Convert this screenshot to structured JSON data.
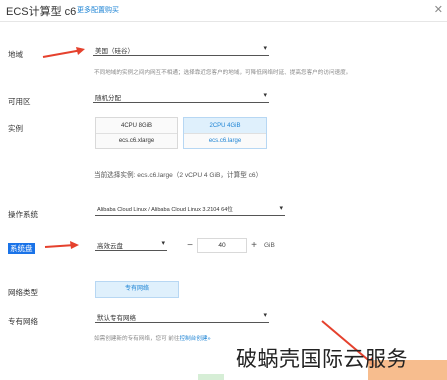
{
  "header": {
    "title": "ECS计算型 c6",
    "more_link": "更多配置购买",
    "close": "✕"
  },
  "region": {
    "label": "地域",
    "value": "美国（硅谷）",
    "hint": "不同地域的实例之间内网互不相通；选择靠近您客户的地域，可降低网络时延、提高您客户的访问速度。"
  },
  "zone": {
    "label": "可用区",
    "value": "随机分配"
  },
  "instance": {
    "label": "实例",
    "cards": [
      {
        "spec": "4CPU 8GiB",
        "code": "ecs.c6.xlarge",
        "active": false
      },
      {
        "spec": "2CPU 4GiB",
        "code": "ecs.c6.large",
        "active": true
      }
    ],
    "current": "当前选择实例: ecs.c6.large（2 vCPU 4 GiB，计算型 c6）"
  },
  "os": {
    "label": "操作系统",
    "value": "Alibaba Cloud Linux / Alibaba Cloud Linux 3.2104 64位"
  },
  "system_disk": {
    "label": "系统盘",
    "type": "高效云盘",
    "minus": "−",
    "size": "40",
    "plus": "+",
    "unit": "GiB"
  },
  "network_type": {
    "label": "网络类型",
    "option": "专有网络"
  },
  "vpc": {
    "label": "专有网络",
    "value": "默认专有网络",
    "hint_prefix": "如需创建新的专有网络，您可 前往",
    "hint_link": "控制台创建»"
  },
  "watermark": "破蜗壳国际云服务",
  "colors": {
    "accent": "#1c83d4",
    "arrow": "#e5412d",
    "highlight": "#1a73e8"
  }
}
